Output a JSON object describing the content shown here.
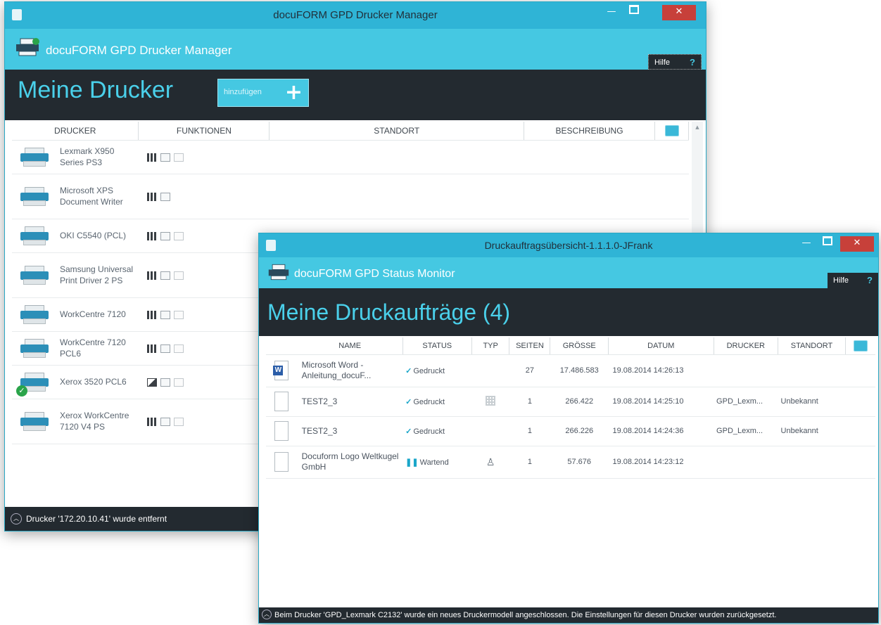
{
  "manager": {
    "window_title": "docuFORM GPD Drucker Manager",
    "app_name": "docuFORM GPD Drucker Manager",
    "help": "Hilfe",
    "help_q": "?",
    "heading": "Meine Drucker",
    "add_label": "hinzufügen",
    "add_plus": "+",
    "columns": [
      "DRUCKER",
      "FUNKTIONEN",
      "STANDORT",
      "BESCHREIBUNG"
    ],
    "printers": [
      {
        "name": "Lexmark X950 Series PS3",
        "functions": [
          "bars",
          "page",
          "page2"
        ],
        "default": false
      },
      {
        "name": "Microsoft XPS Document Writer",
        "functions": [
          "bars",
          "page"
        ],
        "default": false
      },
      {
        "name": "OKI C5540 (PCL)",
        "functions": [
          "bars",
          "page",
          "page2"
        ],
        "default": false
      },
      {
        "name": "Samsung Universal Print Driver 2 PS",
        "functions": [
          "bars",
          "page",
          "page2"
        ],
        "default": false
      },
      {
        "name": "WorkCentre 7120",
        "functions": [
          "bars",
          "page",
          "page2"
        ],
        "default": false
      },
      {
        "name": "WorkCentre 7120 PCL6",
        "functions": [
          "bars",
          "page",
          "page2"
        ],
        "default": false
      },
      {
        "name": "Xerox 3520 PCL6",
        "functions": [
          "mono",
          "page",
          "page2"
        ],
        "default": true
      },
      {
        "name": "Xerox WorkCentre 7120 V4 PS",
        "functions": [
          "bars",
          "page",
          "page2"
        ],
        "default": false
      }
    ],
    "status": "Drucker '172.20.10.41' wurde entfernt"
  },
  "monitor": {
    "window_title": "Druckauftragsübersicht-1.1.1.0-JFrank",
    "app_name": "docuFORM GPD Status Monitor",
    "help": "Hilfe",
    "help_q": "?",
    "heading": "Meine Druckaufträge (4)",
    "columns": [
      "NAME",
      "STATUS",
      "TYP",
      "SEITEN",
      "GRÖSSE",
      "DATUM",
      "DRUCKER",
      "STANDORT"
    ],
    "jobs": [
      {
        "icon": "word-doc-icon",
        "name": "Microsoft Word - Anleitung_docuF...",
        "status": "Gedruckt",
        "status_icon": "check",
        "type": "",
        "pages": "27",
        "size": "17.486.583",
        "date": "19.08.2014 14:26:13",
        "printer": "",
        "location": ""
      },
      {
        "icon": "document-icon",
        "name": "TEST2_3",
        "status": "Gedruckt",
        "status_icon": "check",
        "type": "grid",
        "pages": "1",
        "size": "266.422",
        "date": "19.08.2014 14:25:10",
        "printer": "GPD_Lexm...",
        "location": "Unbekannt"
      },
      {
        "icon": "document-icon",
        "name": "TEST2_3",
        "status": "Gedruckt",
        "status_icon": "check",
        "type": "",
        "pages": "1",
        "size": "266.226",
        "date": "19.08.2014 14:24:36",
        "printer": "GPD_Lexm...",
        "location": "Unbekannt"
      },
      {
        "icon": "document-icon",
        "name": "Docuform Logo Weltkugel GmbH",
        "status": "Wartend",
        "status_icon": "pause",
        "type": "user",
        "pages": "1",
        "size": "57.676",
        "date": "19.08.2014 14:23:12",
        "printer": "",
        "location": ""
      }
    ],
    "status": "Beim Drucker 'GPD_Lexmark C2132' wurde ein neues Druckermodell angeschlossen. Die Einstellungen für diesen Drucker wurden zurückgesetzt."
  },
  "colors": {
    "accent": "#45c8e2",
    "dark": "#232a30",
    "close": "#c7403a",
    "ok": "#2aa44a"
  }
}
